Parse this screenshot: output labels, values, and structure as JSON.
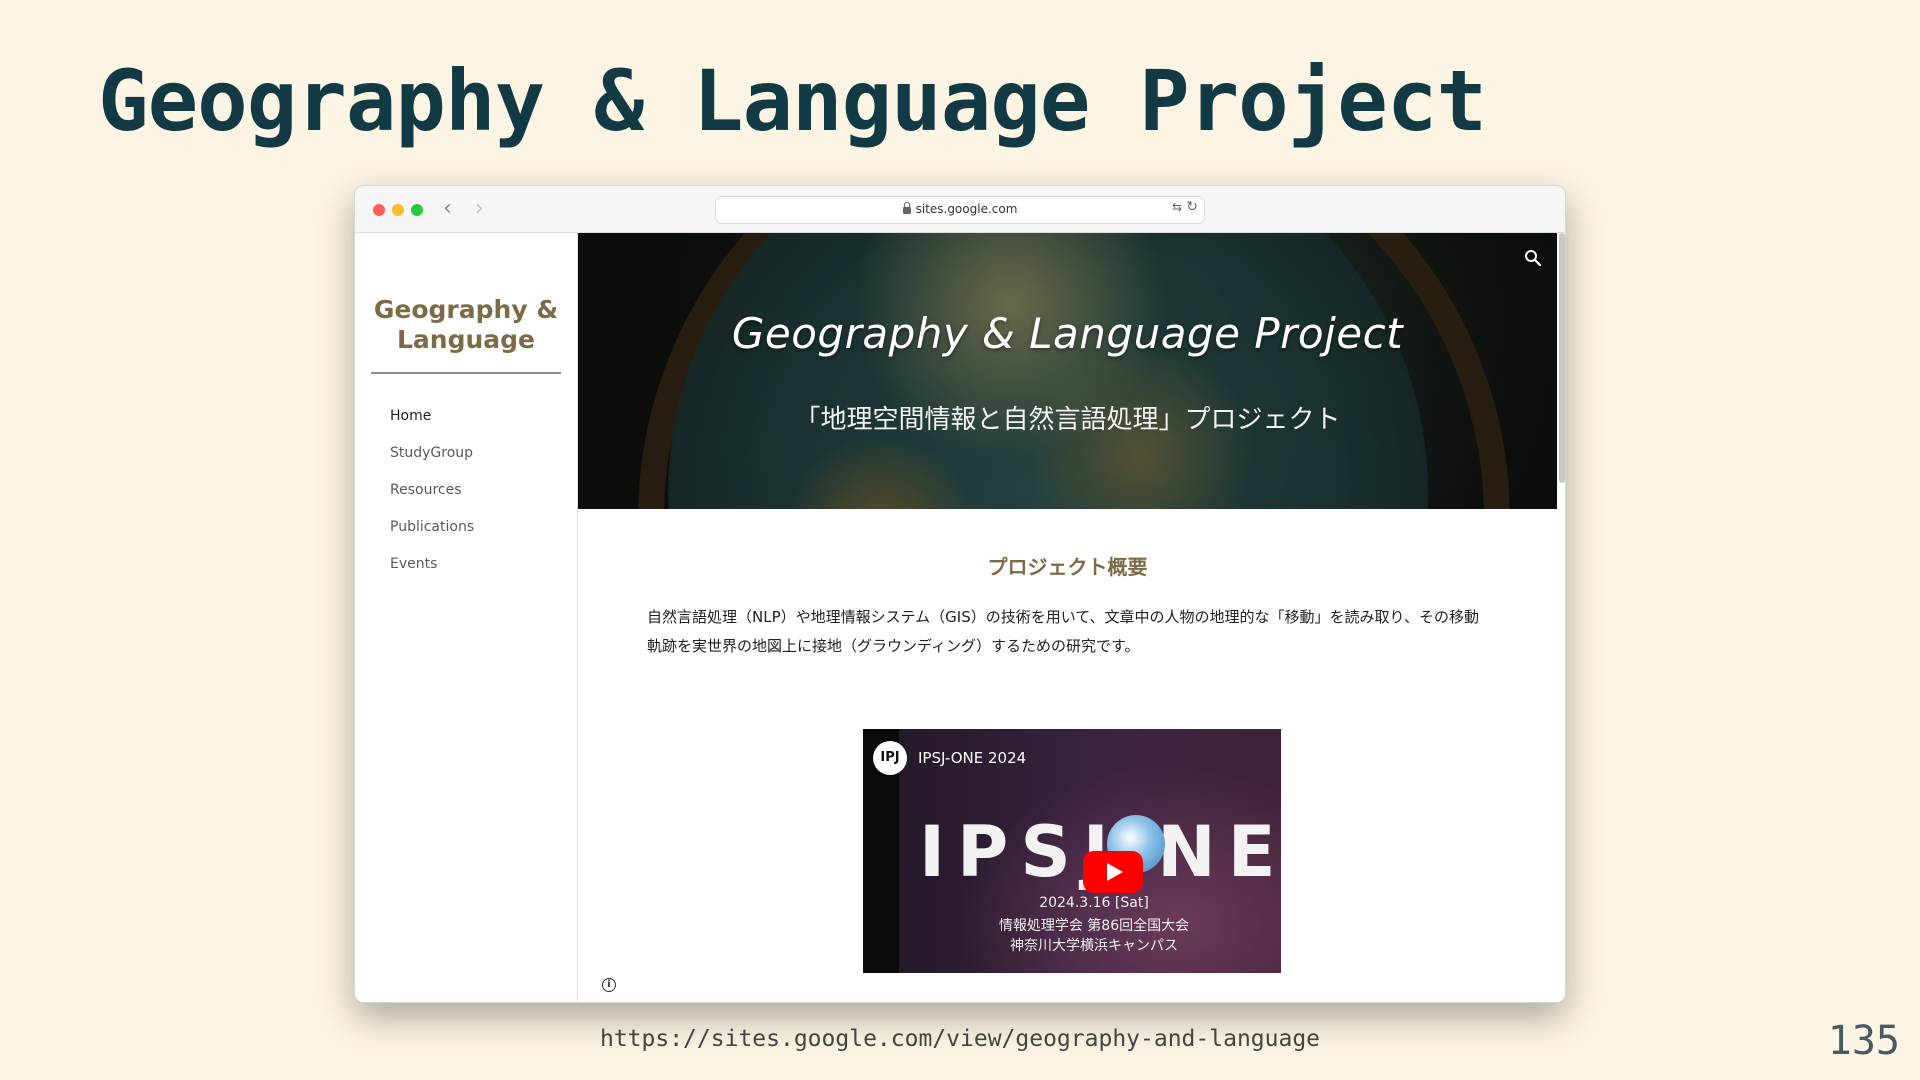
{
  "slide": {
    "title": "Geography & Language Project",
    "source_url": "https://sites.google.com/view/geography-and-language",
    "page_number": "135"
  },
  "browser": {
    "url": "sites.google.com",
    "back_symbol": "‹",
    "forward_symbol": "›",
    "translate_symbol": "⇆",
    "reload_symbol": "↻"
  },
  "sidebar": {
    "site_title": "Geography & Language",
    "nav_items": [
      "Home",
      "StudyGroup",
      "Resources",
      "Publications",
      "Events"
    ],
    "active_item": "Home"
  },
  "hero": {
    "title": "Geography & Language Project",
    "subtitle": "「地理空間情報と自然言語処理」プロジェクト"
  },
  "content": {
    "section_heading": "プロジェクト概要",
    "body": "自然言語処理（NLP）や地理情報システム（GIS）の技術を用いて、文章中の人物の地理的な「移動」を読み取り、その移動軌跡を実世界の地図上に接地（グラウンディング）するための研究です。"
  },
  "video": {
    "logo_text": "IPJ",
    "channel": "IPSJ-ONE 2024",
    "brand": "IPSJ NE",
    "date": "2024.3.16 [Sat]",
    "line2": "情報処理学会 第86回全国大会",
    "line3": "神奈川大学横浜キャンパス"
  },
  "colors": {
    "slide_background": "#fcf5e3",
    "slide_title": "#113a45",
    "site_accent": "#7d6b48",
    "play_button": "#ff0000"
  }
}
